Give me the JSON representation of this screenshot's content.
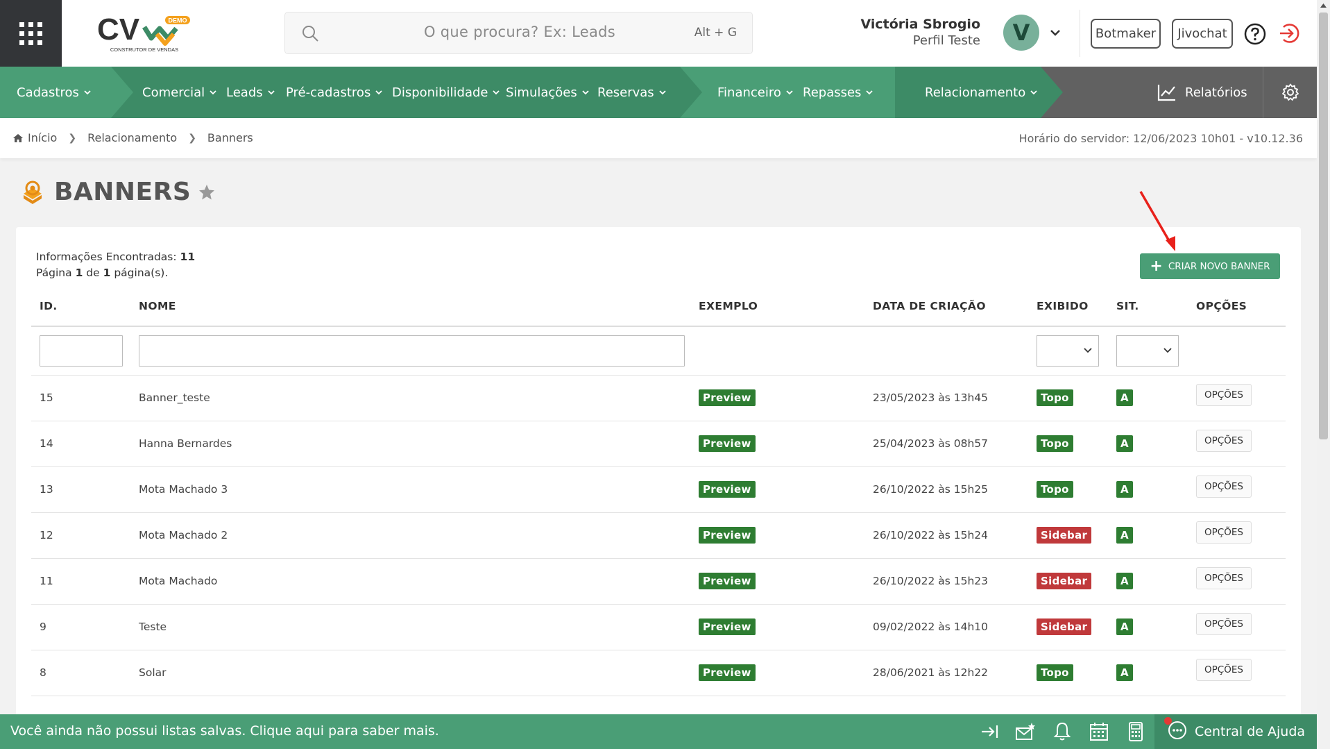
{
  "header": {
    "logo_text": "CV",
    "logo_tag": "DEMO",
    "logo_sub": "CONSTRUTOR DE VENDAS",
    "search_placeholder": "O que procura? Ex: Leads",
    "search_shortcut": "Alt + G",
    "user_name": "Victória Sbrogio",
    "user_role": "Perfil Teste",
    "avatar_letter": "V",
    "btn_botmaker": "Botmaker",
    "btn_jivochat": "Jivochat"
  },
  "nav": {
    "items": [
      {
        "label": "Cadastros"
      },
      {
        "label": "Comercial"
      },
      {
        "label": "Leads"
      },
      {
        "label": "Pré-cadastros"
      },
      {
        "label": "Disponibilidade"
      },
      {
        "label": "Simulações"
      },
      {
        "label": "Reservas"
      },
      {
        "label": "Financeiro"
      },
      {
        "label": "Repasses"
      },
      {
        "label": "Relacionamento"
      }
    ],
    "reports": "Relatórios"
  },
  "breadcrumb": {
    "home": "Início",
    "section": "Relacionamento",
    "current": "Banners",
    "server_time": "Horário do servidor: 12/06/2023 10h01 - v10.12.36"
  },
  "page": {
    "title": "BANNERS",
    "info_label": "Informações Encontradas:",
    "info_count": "11",
    "page_word": "Página",
    "page_current": "1",
    "page_of": "de",
    "page_total": "1",
    "page_suffix": "página(s).",
    "create_button": "CRIAR NOVO BANNER"
  },
  "table": {
    "headers": {
      "id": "ID.",
      "name": "NOME",
      "example": "EXEMPLO",
      "created": "DATA DE CRIAÇÃO",
      "shown": "EXIBIDO",
      "sit": "SIT.",
      "options": "OPÇÕES"
    },
    "rows": [
      {
        "id": "15",
        "name": "Banner_teste",
        "example": "Preview",
        "created": "23/05/2023 às 13h45",
        "shown": "Topo",
        "sit": "A",
        "options": "OPÇÕES"
      },
      {
        "id": "14",
        "name": "Hanna Bernardes",
        "example": "Preview",
        "created": "25/04/2023 às 08h57",
        "shown": "Topo",
        "sit": "A",
        "options": "OPÇÕES"
      },
      {
        "id": "13",
        "name": "Mota Machado 3",
        "example": "Preview",
        "created": "26/10/2022 às 15h25",
        "shown": "Topo",
        "sit": "A",
        "options": "OPÇÕES"
      },
      {
        "id": "12",
        "name": "Mota Machado 2",
        "example": "Preview",
        "created": "26/10/2022 às 15h24",
        "shown": "Sidebar",
        "sit": "A",
        "options": "OPÇÕES"
      },
      {
        "id": "11",
        "name": "Mota Machado",
        "example": "Preview",
        "created": "26/10/2022 às 15h23",
        "shown": "Sidebar",
        "sit": "A",
        "options": "OPÇÕES"
      },
      {
        "id": "9",
        "name": "Teste",
        "example": "Preview",
        "created": "09/02/2022 às 14h10",
        "shown": "Sidebar",
        "sit": "A",
        "options": "OPÇÕES"
      },
      {
        "id": "8",
        "name": "Solar",
        "example": "Preview",
        "created": "28/06/2021 às 12h22",
        "shown": "Topo",
        "sit": "A",
        "options": "OPÇÕES"
      }
    ]
  },
  "bottom": {
    "message": "Você ainda não possui listas salvas. Clique aqui para saber mais.",
    "help_center": "Central de Ajuda"
  },
  "colors": {
    "brand_green": "#4a9e76",
    "brand_green_dark": "#3d8b66",
    "badge_green": "#2e7d32",
    "badge_red": "#c0393b",
    "nav_grey": "#616161"
  }
}
